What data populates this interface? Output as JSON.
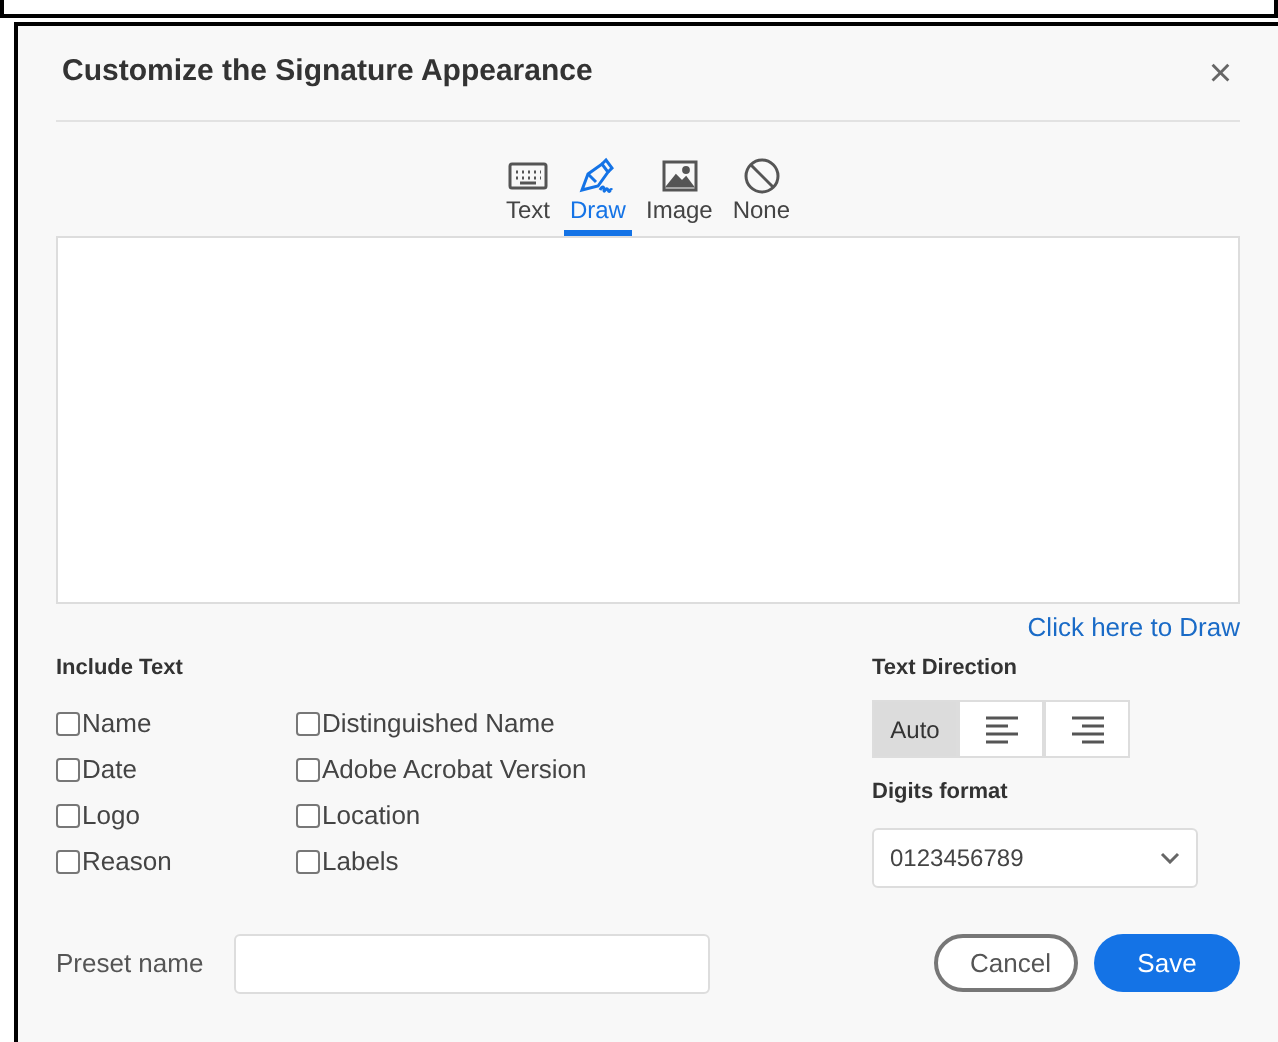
{
  "dialog": {
    "title": "Customize the Signature Appearance",
    "close": "×"
  },
  "tabs": [
    {
      "kind": "keyboard",
      "label": "Text",
      "selected": false
    },
    {
      "kind": "pen",
      "label": "Draw",
      "selected": true
    },
    {
      "kind": "image",
      "label": "Image",
      "selected": false
    },
    {
      "kind": "none",
      "label": "None",
      "selected": false
    }
  ],
  "draw_link": "Click here to Draw",
  "include_text": {
    "title": "Include Text",
    "columns": [
      [
        {
          "label": "Name",
          "checked": false
        },
        {
          "label": "Date",
          "checked": false
        },
        {
          "label": "Logo",
          "checked": false
        },
        {
          "label": "Reason",
          "checked": false
        }
      ],
      [
        {
          "label": "Distinguished Name",
          "checked": false
        },
        {
          "label": "Adobe Acrobat Version",
          "checked": false
        },
        {
          "label": "Location",
          "checked": false
        },
        {
          "label": "Labels",
          "checked": false
        }
      ]
    ]
  },
  "text_direction": {
    "title": "Text Direction",
    "options": [
      {
        "kind": "text",
        "label": "Auto",
        "selected": true
      },
      {
        "kind": "left",
        "selected": false
      },
      {
        "kind": "right",
        "selected": false
      }
    ]
  },
  "digits_format": {
    "title": "Digits format",
    "value": "0123456789"
  },
  "preset": {
    "label": "Preset name"
  },
  "buttons": [
    {
      "kind": "secondary",
      "label": "Cancel"
    },
    {
      "kind": "primary",
      "label": "Save"
    }
  ]
}
